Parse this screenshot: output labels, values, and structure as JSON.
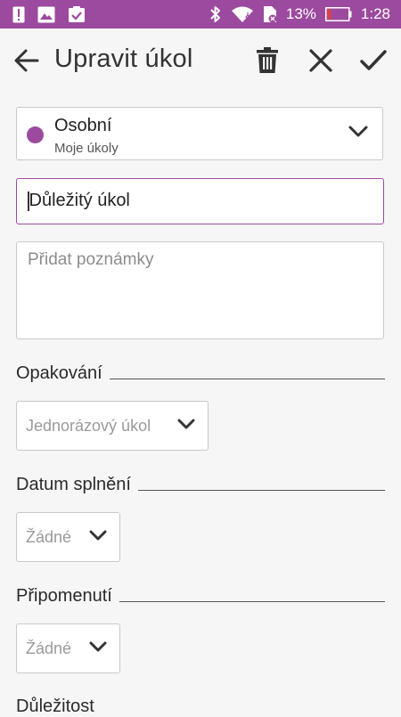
{
  "status_bar": {
    "battery_percent": "13%",
    "time": "1:28",
    "icons": [
      "alert-icon",
      "gallery-icon",
      "clipboard-check-icon",
      "bluetooth-icon",
      "wifi-icon",
      "no-sim-icon",
      "battery-icon"
    ]
  },
  "app_bar": {
    "title": "Upravit úkol",
    "icons": [
      "back-arrow-icon",
      "trash-icon",
      "close-icon",
      "check-icon"
    ]
  },
  "list_picker": {
    "name": "Osobní",
    "subtitle": "Moje úkoly",
    "color": "#9c4a9f"
  },
  "task": {
    "title_value": "Důležitý úkol",
    "notes_placeholder": "Přidat poznámky"
  },
  "sections": {
    "repeat": {
      "label": "Opakování",
      "value": "Jednorázový úkol"
    },
    "due_date": {
      "label": "Datum splnění",
      "value": "Žádné"
    },
    "reminder": {
      "label": "Připomenutí",
      "value": "Žádné"
    },
    "priority": {
      "label": "Důležitost"
    }
  },
  "colors": {
    "accent": "#9c4a9f",
    "background": "#f6f6f6"
  }
}
